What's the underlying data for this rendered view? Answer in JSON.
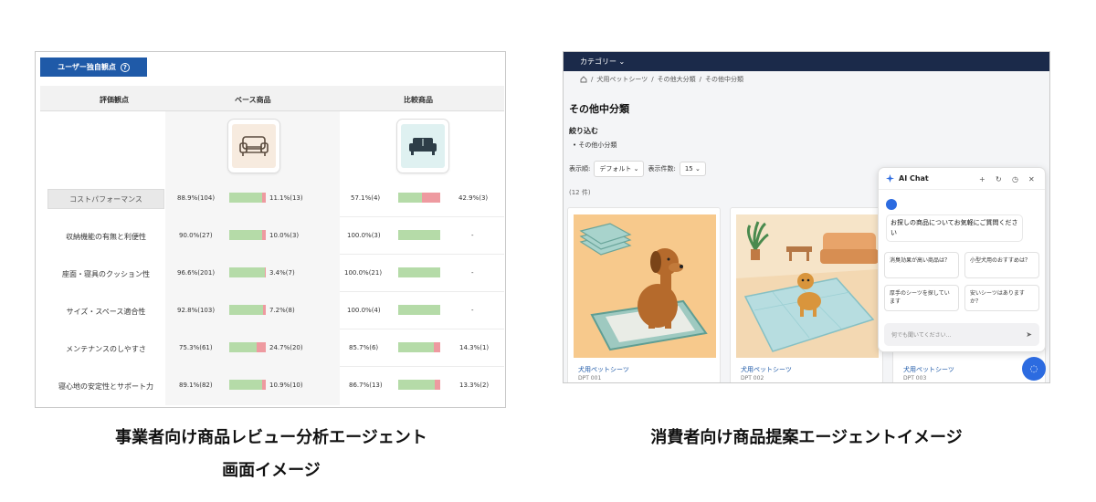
{
  "left": {
    "tab_label": "ユーザー独自観点",
    "tab_help_icon": "?",
    "headers": {
      "criteria": "評価観点",
      "base": "ベース商品",
      "compare": "比較商品"
    },
    "colors": {
      "positive": "#b5dba8",
      "negative": "#ee9aa0",
      "tab": "#1f5aa8"
    },
    "rows": [
      {
        "label": "コストパフォーマンス",
        "base_pos": "88.9%(104)",
        "base_neg": "11.1%(13)",
        "base_pos_frac": 0.889,
        "base_neg_frac": 0.111,
        "cmp_pos": "57.1%(4)",
        "cmp_neg": "42.9%(3)",
        "cmp_pos_frac": 0.571,
        "cmp_neg_frac": 0.429,
        "highlight": true
      },
      {
        "label": "収納機能の有無と利便性",
        "base_pos": "90.0%(27)",
        "base_neg": "10.0%(3)",
        "base_pos_frac": 0.9,
        "base_neg_frac": 0.1,
        "cmp_pos": "100.0%(3)",
        "cmp_neg": "-",
        "cmp_pos_frac": 1.0,
        "cmp_neg_frac": 0,
        "highlight": false
      },
      {
        "label": "座面・寝具のクッション性",
        "base_pos": "96.6%(201)",
        "base_neg": "3.4%(7)",
        "base_pos_frac": 0.966,
        "base_neg_frac": 0.034,
        "cmp_pos": "100.0%(21)",
        "cmp_neg": "-",
        "cmp_pos_frac": 1.0,
        "cmp_neg_frac": 0,
        "highlight": false
      },
      {
        "label": "サイズ・スペース適合性",
        "base_pos": "92.8%(103)",
        "base_neg": "7.2%(8)",
        "base_pos_frac": 0.928,
        "base_neg_frac": 0.072,
        "cmp_pos": "100.0%(4)",
        "cmp_neg": "-",
        "cmp_pos_frac": 1.0,
        "cmp_neg_frac": 0,
        "highlight": false
      },
      {
        "label": "メンテナンスのしやすさ",
        "base_pos": "75.3%(61)",
        "base_neg": "24.7%(20)",
        "base_pos_frac": 0.753,
        "base_neg_frac": 0.247,
        "cmp_pos": "85.7%(6)",
        "cmp_neg": "14.3%(1)",
        "cmp_pos_frac": 0.857,
        "cmp_neg_frac": 0.143,
        "highlight": false
      },
      {
        "label": "寝心地の安定性とサポート力",
        "base_pos": "89.1%(82)",
        "base_neg": "10.9%(10)",
        "base_pos_frac": 0.891,
        "base_neg_frac": 0.109,
        "cmp_pos": "86.7%(13)",
        "cmp_neg": "13.3%(2)",
        "cmp_pos_frac": 0.867,
        "cmp_neg_frac": 0.133,
        "highlight": false
      }
    ]
  },
  "right": {
    "nav_category": "カテゴリー ⌄",
    "breadcrumb": [
      "犬用ペットシーツ",
      "その他大分類",
      "その他中分類"
    ],
    "page_title": "その他中分類",
    "filter_heading": "絞り込む",
    "filter_item": "その他小分類",
    "sort_label": "表示順:",
    "sort_value": "デフォルト",
    "per_page_label": "表示件数:",
    "per_page_value": "15",
    "result_count": "(12 件)",
    "products": [
      {
        "name": "犬用ペットシーツ",
        "code": "DPT 001"
      },
      {
        "name": "犬用ペットシーツ",
        "code": "DPT 002"
      },
      {
        "name": "犬用ペットシーツ",
        "code": "DPT 003"
      }
    ],
    "chat": {
      "title": "AI Chat",
      "greeting": "お探しの商品についてお気軽にご質問ください",
      "suggestions": [
        "消臭効果が高い商品は？",
        "小型犬用のおすすめは？",
        "厚手のシーツを探しています",
        "安いシーツはありますか？"
      ],
      "input_placeholder": "何でも聞いてください..."
    }
  },
  "captions": {
    "left_line1": "事業者向け商品レビュー分析エージェント",
    "left_line2": "画面イメージ",
    "right": "消費者向け商品提案エージェントイメージ"
  }
}
